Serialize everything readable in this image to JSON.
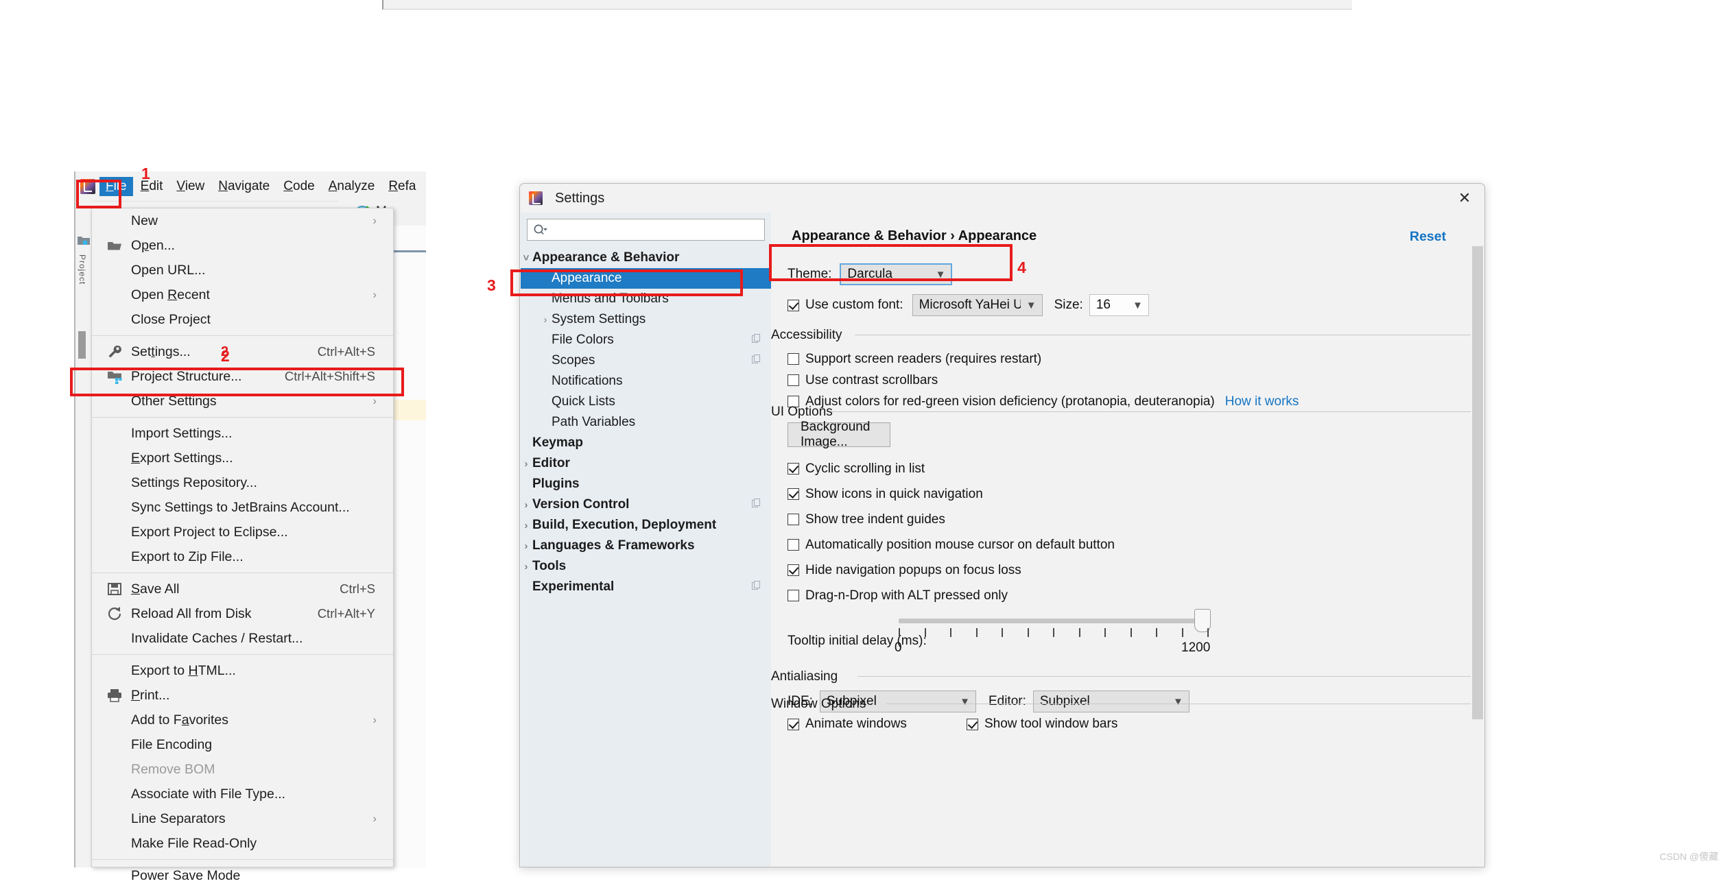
{
  "ide": {
    "logo_icon": "intellij-logo-icon",
    "menubar": [
      {
        "pre": "",
        "u": "F",
        "post": "ile",
        "selected": true
      },
      {
        "pre": "",
        "u": "E",
        "post": "dit",
        "selected": false
      },
      {
        "pre": "",
        "u": "V",
        "post": "iew",
        "selected": false
      },
      {
        "pre": "",
        "u": "N",
        "post": "avigate",
        "selected": false
      },
      {
        "pre": "",
        "u": "C",
        "post": "ode",
        "selected": false
      },
      {
        "pre": "",
        "u": "A",
        "post": "nalyze",
        "selected": false
      },
      {
        "pre": "",
        "u": "R",
        "post": "efa",
        "selected": false
      }
    ],
    "left_stripe_label": "Project"
  },
  "file_menu": {
    "items": [
      {
        "label": "New",
        "shortcut": "",
        "submenu": true,
        "icon": "",
        "disabled": false
      },
      {
        "label": "Open...",
        "shortcut": "",
        "submenu": false,
        "icon": "folder-icon",
        "disabled": false,
        "u": "O",
        "upos": 1
      },
      {
        "label": "Open URL...",
        "shortcut": "",
        "submenu": false,
        "icon": "",
        "disabled": false
      },
      {
        "label": "Open Recent",
        "shortcut": "",
        "submenu": true,
        "icon": "",
        "disabled": false,
        "u": "R",
        "upos": 5
      },
      {
        "label": "Close Project",
        "shortcut": "",
        "submenu": false,
        "icon": "",
        "disabled": false
      },
      {
        "separator": true
      },
      {
        "label": "Settings...",
        "shortcut": "Ctrl+Alt+S",
        "submenu": false,
        "icon": "wrench-icon",
        "disabled": false,
        "note": "2",
        "u": "t",
        "upos": 3
      },
      {
        "label": "Project Structure...",
        "shortcut": "Ctrl+Alt+Shift+S",
        "submenu": false,
        "icon": "project-structure-icon",
        "disabled": false
      },
      {
        "label": "Other Settings",
        "shortcut": "",
        "submenu": true,
        "icon": "",
        "disabled": false
      },
      {
        "separator": true
      },
      {
        "label": "Import Settings...",
        "shortcut": "",
        "submenu": false,
        "icon": "",
        "disabled": false
      },
      {
        "label": "Export Settings...",
        "shortcut": "",
        "submenu": false,
        "icon": "",
        "disabled": false,
        "u": "E",
        "upos": 0
      },
      {
        "label": "Settings Repository...",
        "shortcut": "",
        "submenu": false,
        "icon": "",
        "disabled": false
      },
      {
        "label": "Sync Settings to JetBrains Account...",
        "shortcut": "",
        "submenu": false,
        "icon": "",
        "disabled": false
      },
      {
        "label": "Export Project to Eclipse...",
        "shortcut": "",
        "submenu": false,
        "icon": "",
        "disabled": false
      },
      {
        "label": "Export to Zip File...",
        "shortcut": "",
        "submenu": false,
        "icon": "",
        "disabled": false
      },
      {
        "separator": true
      },
      {
        "label": "Save All",
        "shortcut": "Ctrl+S",
        "submenu": false,
        "icon": "save-icon",
        "disabled": false,
        "u": "S",
        "upos": 0
      },
      {
        "label": "Reload All from Disk",
        "shortcut": "Ctrl+Alt+Y",
        "submenu": false,
        "icon": "reload-icon",
        "disabled": false
      },
      {
        "label": "Invalidate Caches / Restart...",
        "shortcut": "",
        "submenu": false,
        "icon": "",
        "disabled": false
      },
      {
        "separator": true
      },
      {
        "label": "Export to HTML...",
        "shortcut": "",
        "submenu": false,
        "icon": "",
        "disabled": false,
        "u": "H",
        "upos": 10
      },
      {
        "label": "Print...",
        "shortcut": "",
        "submenu": false,
        "icon": "printer-icon",
        "disabled": false,
        "u": "P",
        "upos": 0
      },
      {
        "label": "Add to Favorites",
        "shortcut": "",
        "submenu": true,
        "icon": "",
        "disabled": false,
        "u": "a",
        "upos": 8
      },
      {
        "label": "File Encoding",
        "shortcut": "",
        "submenu": false,
        "icon": "",
        "disabled": false
      },
      {
        "label": "Remove BOM",
        "shortcut": "",
        "submenu": false,
        "icon": "",
        "disabled": true
      },
      {
        "label": "Associate with File Type...",
        "shortcut": "",
        "submenu": false,
        "icon": "",
        "disabled": false
      },
      {
        "label": "Line Separators",
        "shortcut": "",
        "submenu": true,
        "icon": "",
        "disabled": false
      },
      {
        "label": "Make File Read-Only",
        "shortcut": "",
        "submenu": false,
        "icon": "",
        "disabled": false
      },
      {
        "separator": true
      },
      {
        "label": "Power Save Mode",
        "shortcut": "",
        "submenu": false,
        "icon": "",
        "disabled": false
      }
    ]
  },
  "settings": {
    "title": "Settings",
    "title_icon": "intellij-logo-icon",
    "close_icon": "close-icon",
    "search": {
      "placeholder": "",
      "value": "",
      "icon": "search-icon"
    },
    "reset_label": "Reset",
    "breadcrumb": "Appearance & Behavior  ›  Appearance",
    "tree": [
      {
        "label": "Appearance & Behavior",
        "level": 0,
        "bold": true,
        "chev": "down",
        "selected": false,
        "copy": false
      },
      {
        "label": "Appearance",
        "level": 1,
        "bold": false,
        "chev": "",
        "selected": true,
        "copy": false
      },
      {
        "label": "Menus and Toolbars",
        "level": 1,
        "bold": false,
        "chev": "",
        "selected": false,
        "copy": false
      },
      {
        "label": "System Settings",
        "level": 1,
        "bold": false,
        "chev": "right",
        "selected": false,
        "copy": false
      },
      {
        "label": "File Colors",
        "level": 1,
        "bold": false,
        "chev": "",
        "selected": false,
        "copy": true
      },
      {
        "label": "Scopes",
        "level": 1,
        "bold": false,
        "chev": "",
        "selected": false,
        "copy": true
      },
      {
        "label": "Notifications",
        "level": 1,
        "bold": false,
        "chev": "",
        "selected": false,
        "copy": false
      },
      {
        "label": "Quick Lists",
        "level": 1,
        "bold": false,
        "chev": "",
        "selected": false,
        "copy": false
      },
      {
        "label": "Path Variables",
        "level": 1,
        "bold": false,
        "chev": "",
        "selected": false,
        "copy": false
      },
      {
        "label": "Keymap",
        "level": 0,
        "bold": true,
        "chev": "",
        "selected": false,
        "copy": false
      },
      {
        "label": "Editor",
        "level": 0,
        "bold": true,
        "chev": "right",
        "selected": false,
        "copy": false
      },
      {
        "label": "Plugins",
        "level": 0,
        "bold": true,
        "chev": "",
        "selected": false,
        "copy": false
      },
      {
        "label": "Version Control",
        "level": 0,
        "bold": true,
        "chev": "right",
        "selected": false,
        "copy": true
      },
      {
        "label": "Build, Execution, Deployment",
        "level": 0,
        "bold": true,
        "chev": "right",
        "selected": false,
        "copy": false
      },
      {
        "label": "Languages & Frameworks",
        "level": 0,
        "bold": true,
        "chev": "right",
        "selected": false,
        "copy": false
      },
      {
        "label": "Tools",
        "level": 0,
        "bold": true,
        "chev": "right",
        "selected": false,
        "copy": false
      },
      {
        "label": "Experimental",
        "level": 0,
        "bold": true,
        "chev": "",
        "selected": false,
        "copy": true
      }
    ],
    "theme": {
      "label": "Theme:",
      "value": "Darcula"
    },
    "custom_font": {
      "label": "Use custom font:",
      "checked": true,
      "value": "Microsoft YaHei UI"
    },
    "font_size": {
      "label": "Size:",
      "value": "16"
    },
    "accessibility": {
      "title": "Accessibility",
      "items": [
        {
          "label": "Support screen readers (requires restart)",
          "checked": false
        },
        {
          "label": "Use contrast scrollbars",
          "checked": false
        },
        {
          "label": "Adjust colors for red-green vision deficiency (protanopia, deuteranopia)",
          "checked": false
        }
      ],
      "how_it_works": "How it works"
    },
    "ui_options": {
      "title": "UI Options",
      "background_image_button": "Background Image...",
      "items": [
        {
          "label": "Cyclic scrolling in list",
          "checked": true
        },
        {
          "label": "Show icons in quick navigation",
          "checked": true
        },
        {
          "label": "Show tree indent guides",
          "checked": false
        },
        {
          "label": "Automatically position mouse cursor on default button",
          "checked": false
        },
        {
          "label": "Hide navigation popups on focus loss",
          "checked": true
        },
        {
          "label": "Drag-n-Drop with ALT pressed only",
          "checked": false
        }
      ],
      "tooltip_delay": {
        "label": "Tooltip initial delay (ms):",
        "min": "0",
        "max": "1200",
        "value": "1200"
      }
    },
    "antialiasing": {
      "title": "Antialiasing",
      "ide": {
        "label": "IDE:",
        "value": "Subpixel"
      },
      "editor": {
        "label": "Editor:",
        "value": "Subpixel"
      }
    },
    "window_options": {
      "title": "Window Options",
      "animate": {
        "label": "Animate windows",
        "checked": true
      },
      "tool_bars": {
        "label": "Show tool window bars",
        "checked": true
      }
    }
  },
  "annotations": {
    "accent_red": "#e81b1b",
    "markers": [
      {
        "n": "1"
      },
      {
        "n": "2"
      },
      {
        "n": "3"
      },
      {
        "n": "4"
      }
    ]
  },
  "watermark": "CSDN @傻藏"
}
